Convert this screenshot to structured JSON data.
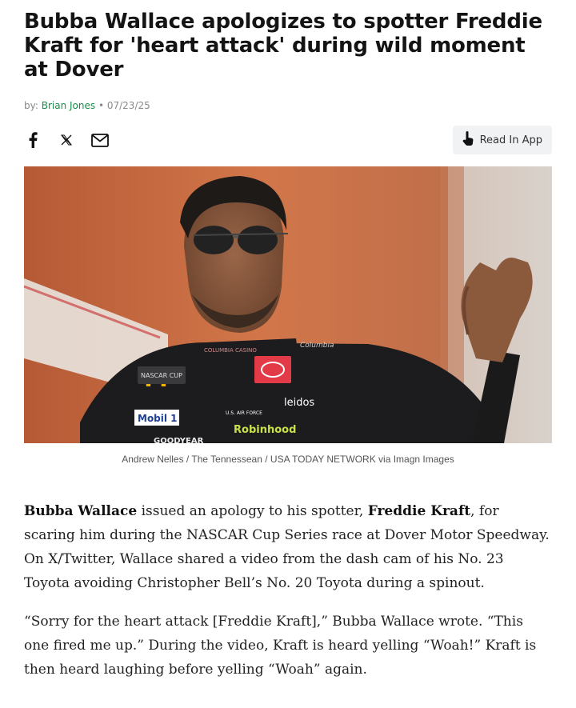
{
  "article": {
    "headline": "Bubba Wallace apologizes to spotter Freddie Kraft for 'heart attack' during wild moment at Dover",
    "byline_prefix": "by:",
    "author": "Brian Jones",
    "separator": "•",
    "date": "07/23/25"
  },
  "share": {
    "facebook_icon": "facebook-icon",
    "x_icon": "x-twitter-icon",
    "email_icon": "email-icon",
    "read_in_app_label": "Read In App",
    "read_in_app_icon": "tap-hand-icon"
  },
  "hero_image": {
    "caption": "Andrew Nelles / The Tennessean / USA TODAY NETWORK via Imagn Images",
    "sponsor_texts": [
      "NASCAR CUP SERIES",
      "Mobil 1",
      "Robinhood",
      "leidos",
      "U.S. AIR FORCE",
      "GOODYEAR",
      "Columbia",
      "COLUMBIA CASINO"
    ]
  },
  "body": {
    "p1_name1": "Bubba Wallace",
    "p1_text1": " issued an apology to his spotter, ",
    "p1_name2": "Freddie Kraft",
    "p1_text2": ", for scaring him during the NASCAR Cup Series race at Dover Motor Speedway. On X/Twitter, Wallace shared a video from the dash cam of his No. 23 Toyota avoiding Christopher Bell’s No. 20 Toyota during a spinout.",
    "p2": "“Sorry for the heart attack [Freddie Kraft],” Bubba Wallace wrote. “This one fired me up.” During the video, Kraft is heard yelling “Woah!” Kraft is then heard laughing before yelling “Woah” again."
  },
  "colors": {
    "author_link": "#1a8f4a",
    "read_app_bg": "#f1f2f3"
  }
}
